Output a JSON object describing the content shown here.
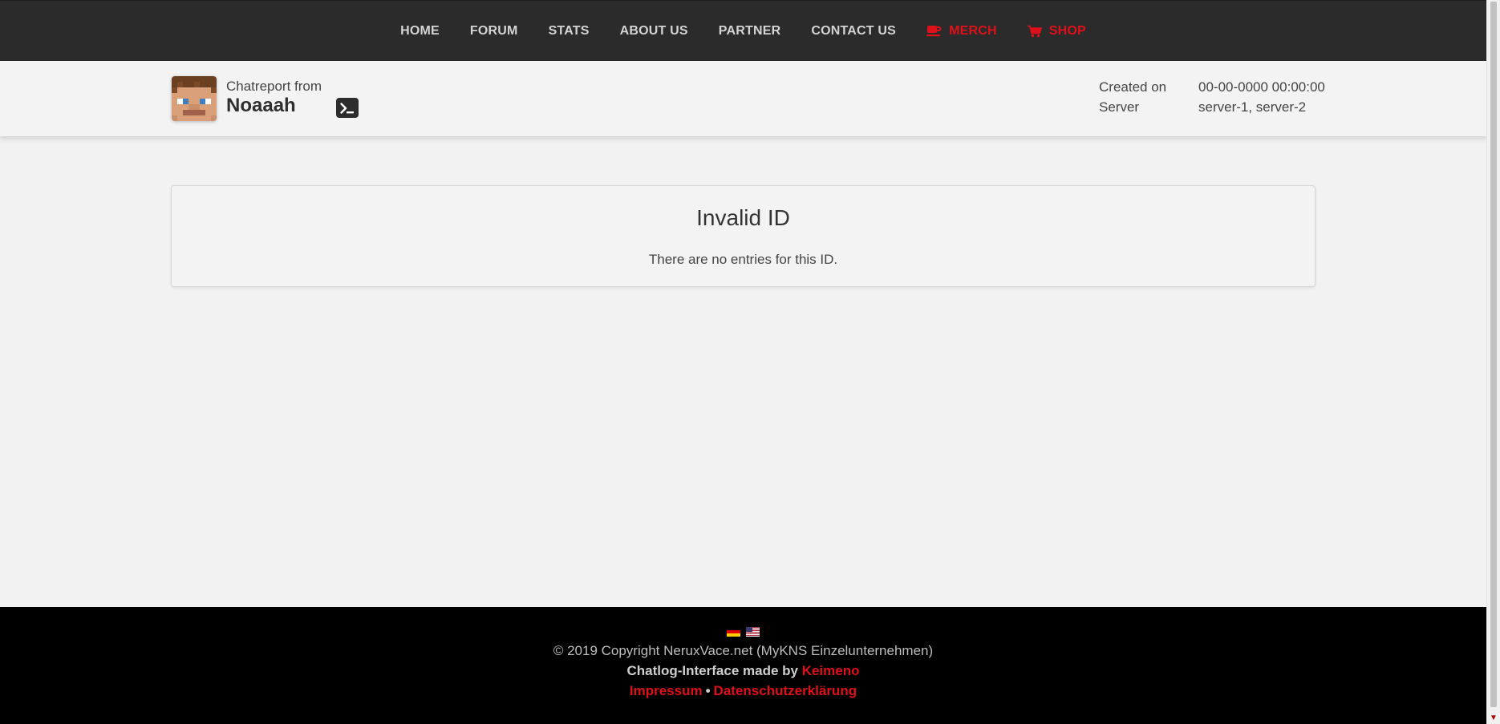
{
  "nav": {
    "items": [
      {
        "label": "HOME",
        "accent": false
      },
      {
        "label": "FORUM",
        "accent": false
      },
      {
        "label": "STATS",
        "accent": false
      },
      {
        "label": "ABOUT US",
        "accent": false
      },
      {
        "label": "PARTNER",
        "accent": false
      },
      {
        "label": "CONTACT US",
        "accent": false
      },
      {
        "label": "MERCH",
        "accent": true,
        "icon": "coffee-cup-icon"
      },
      {
        "label": "SHOP",
        "accent": true,
        "icon": "shopping-cart-icon"
      }
    ],
    "accent_color": "#e0101a"
  },
  "report": {
    "from_label": "Chatreport from",
    "player_name": "Noaaah",
    "avatar_icon": "player-skin-avatar",
    "console_icon": "terminal-icon",
    "meta": {
      "created_label": "Created on",
      "created_value": "00-00-0000 00:00:00",
      "server_label": "Server",
      "server_value": "server-1, server-2"
    }
  },
  "card": {
    "title": "Invalid ID",
    "text": "There are no entries for this ID."
  },
  "footer": {
    "flags": [
      "german-flag-icon",
      "us-flag-icon"
    ],
    "copyright": "© 2019 Copyright NeruxVace.net (MyKNS Einzelunternehmen)",
    "madeby_prefix": "Chatlog-Interface made by ",
    "madeby_link": "Keimeno",
    "impressum": "Impressum",
    "separator": "•",
    "privacy": "Datenschutzerklärung"
  }
}
